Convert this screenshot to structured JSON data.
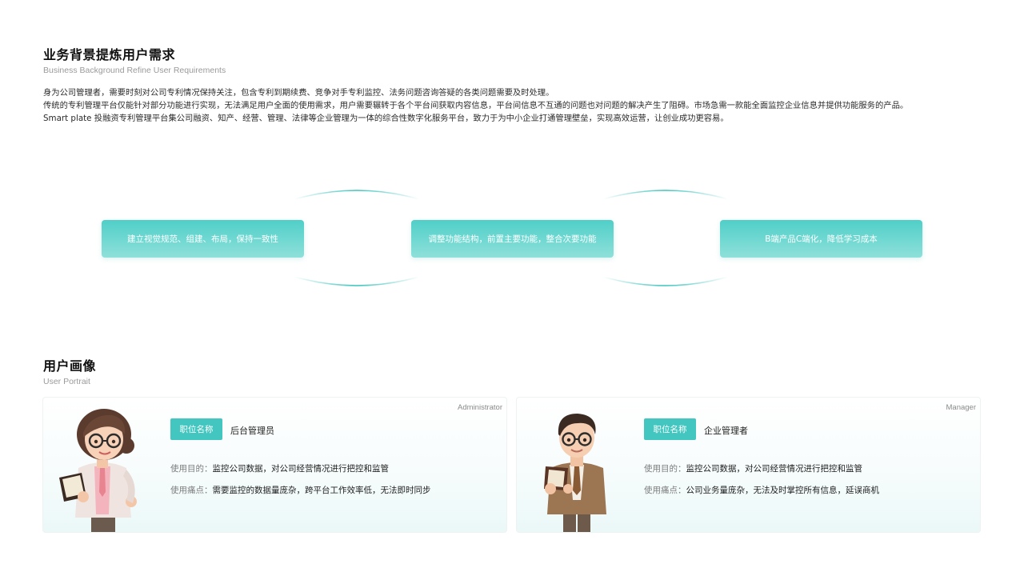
{
  "background": {
    "title": "业务背景提炼用户需求",
    "subtitle": "Business Background Refine User Requirements",
    "paragraphs": [
      "身为公司管理者，需要时刻对公司专利情况保持关注，包含专利到期续费、竞争对手专利监控、法务问题咨询答疑的各类问题需要及时处理。",
      "传统的专利管理平台仅能针对部分功能进行实现，无法满足用户全面的使用需求，用户需要辗转于各个平台间获取内容信息，平台间信息不互通的问题也对问题的解决产生了阻碍。市场急需一款能全面监控企业信息并提供功能服务的产品。",
      "Smart plate 投融资专利管理平台集公司融资、知产、经营、管理、法律等企业管理为一体的综合性数字化服务平台，致力于为中小企业打通管理壁垒，实现高效运营，让创业成功更容易。"
    ]
  },
  "flow": {
    "steps": [
      "建立视觉规范、组建、布局，保持一致性",
      "调整功能结构，前置主要功能，整合次要功能",
      "B端产品C端化，降低学习成本"
    ],
    "colors": {
      "box_top": "#4fcfc8",
      "box_bottom": "#8fe0da",
      "arc": "#3cc4bd"
    }
  },
  "portrait": {
    "title": "用户画像",
    "subtitle": "User Portrait",
    "cards": [
      {
        "role_en": "Administrator",
        "tag": "职位名称",
        "role_name": "后台管理员",
        "purpose_label": "使用目的：",
        "purpose": "监控公司数据，对公司经营情况进行把控和监管",
        "pain_label": "使用痛点：",
        "pain": "需要监控的数据量庞杂，跨平台工作效率低，无法即时同步",
        "avatar": "female-manager-holding-book"
      },
      {
        "role_en": "Manager",
        "tag": "职位名称",
        "role_name": "企业管理者",
        "purpose_label": "使用目的：",
        "purpose": "监控公司数据，对公司经营情况进行把控和监管",
        "pain_label": "使用痛点：",
        "pain": "公司业务量庞杂，无法及时掌控所有信息，延误商机",
        "avatar": "male-manager-holding-book"
      }
    ],
    "colors": {
      "tag": "#43c6bf"
    }
  }
}
